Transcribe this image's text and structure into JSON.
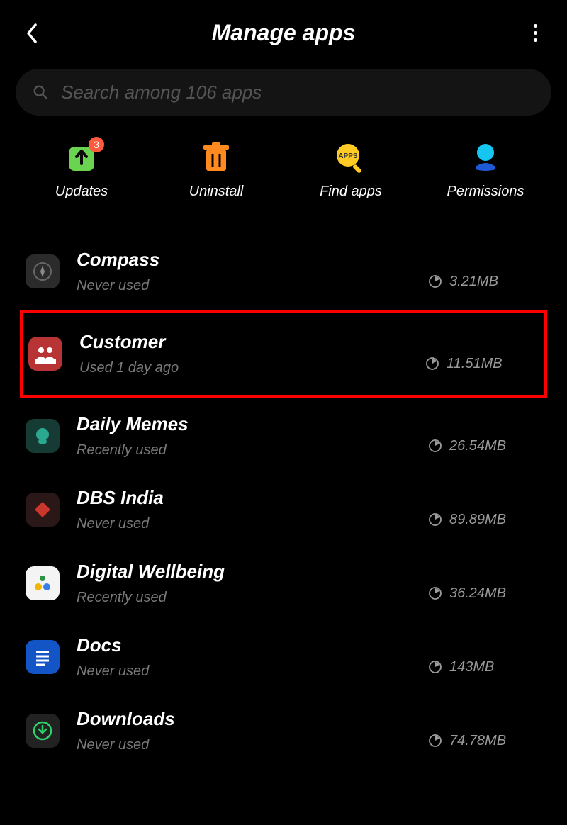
{
  "header": {
    "title": "Manage apps"
  },
  "search": {
    "placeholder": "Search among 106 apps"
  },
  "actions": {
    "updates": {
      "label": "Updates",
      "badge": "3"
    },
    "uninstall": {
      "label": "Uninstall"
    },
    "findapps": {
      "label": "Find apps"
    },
    "permissions": {
      "label": "Permissions"
    }
  },
  "apps": [
    {
      "name": "Compass",
      "usage": "Never used",
      "size": "3.21MB",
      "icon": "compass",
      "highlight": false
    },
    {
      "name": "Customer",
      "usage": "Used 1 day ago",
      "size": "11.51MB",
      "icon": "customer",
      "highlight": true
    },
    {
      "name": "Daily Memes",
      "usage": "Recently used",
      "size": "26.54MB",
      "icon": "memes",
      "highlight": false
    },
    {
      "name": "DBS India",
      "usage": "Never used",
      "size": "89.89MB",
      "icon": "dbs",
      "highlight": false
    },
    {
      "name": "Digital Wellbeing",
      "usage": "Recently used",
      "size": "36.24MB",
      "icon": "wellbeing",
      "highlight": false
    },
    {
      "name": "Docs",
      "usage": "Never used",
      "size": "143MB",
      "icon": "docs",
      "highlight": false
    },
    {
      "name": "Downloads",
      "usage": "Never used",
      "size": "74.78MB",
      "icon": "downloads",
      "highlight": false
    }
  ]
}
